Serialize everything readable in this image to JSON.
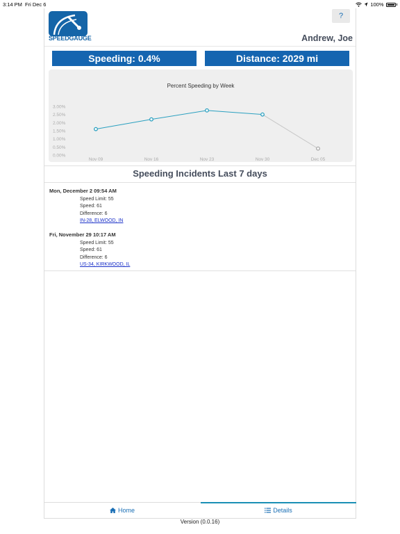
{
  "status_bar": {
    "time": "3:14 PM",
    "date": "Fri Dec 6",
    "battery": "100%",
    "icons": [
      "wifi-icon",
      "location-icon",
      "battery-icon"
    ]
  },
  "header": {
    "logo_text": "SPEEDGAUGE",
    "help_label": "?",
    "user_name": "Andrew, Joe"
  },
  "stats": {
    "speeding": "Speeding: 0.4%",
    "distance": "Distance: 2029 mi"
  },
  "chart_data": {
    "type": "line",
    "title": "Percent Speeding by Week",
    "categories": [
      "Nov 09",
      "Nov 16",
      "Nov 23",
      "Nov 30",
      "Dec 05"
    ],
    "y_ticks": [
      "3.00%",
      "2.50%",
      "2.00%",
      "1.50%",
      "1.00%",
      "0.50%",
      "0.00%"
    ],
    "ylim": [
      0,
      3
    ],
    "series": [
      {
        "values": [
          1.6,
          2.2,
          2.75,
          2.5,
          0.4
        ]
      }
    ],
    "grid": false,
    "colors": {
      "line": "#2aa0c0",
      "last_segment": "#c8c8c8"
    }
  },
  "incidents": {
    "title": "Speeding Incidents Last 7 days",
    "items": [
      {
        "datetime": "Mon, December 2 09:54 AM",
        "speed_limit": "Speed Limit: 55",
        "speed": "Speed: 61",
        "difference": "Difference: 6",
        "location": "IN-28, ELWOOD, IN"
      },
      {
        "datetime": "Fri, November 29 10:17 AM",
        "speed_limit": "Speed Limit: 55",
        "speed": "Speed: 61",
        "difference": "Difference: 6",
        "location": "US-34, KIRKWOOD, IL"
      }
    ]
  },
  "nav": {
    "home_label": "Home",
    "details_label": "Details",
    "active": "Details"
  },
  "footer": {
    "version": "Version (0.0.16)"
  },
  "colors": {
    "brand_blue": "#1565b0",
    "link": "#1a30c8",
    "accent": "#1a8fb5"
  }
}
